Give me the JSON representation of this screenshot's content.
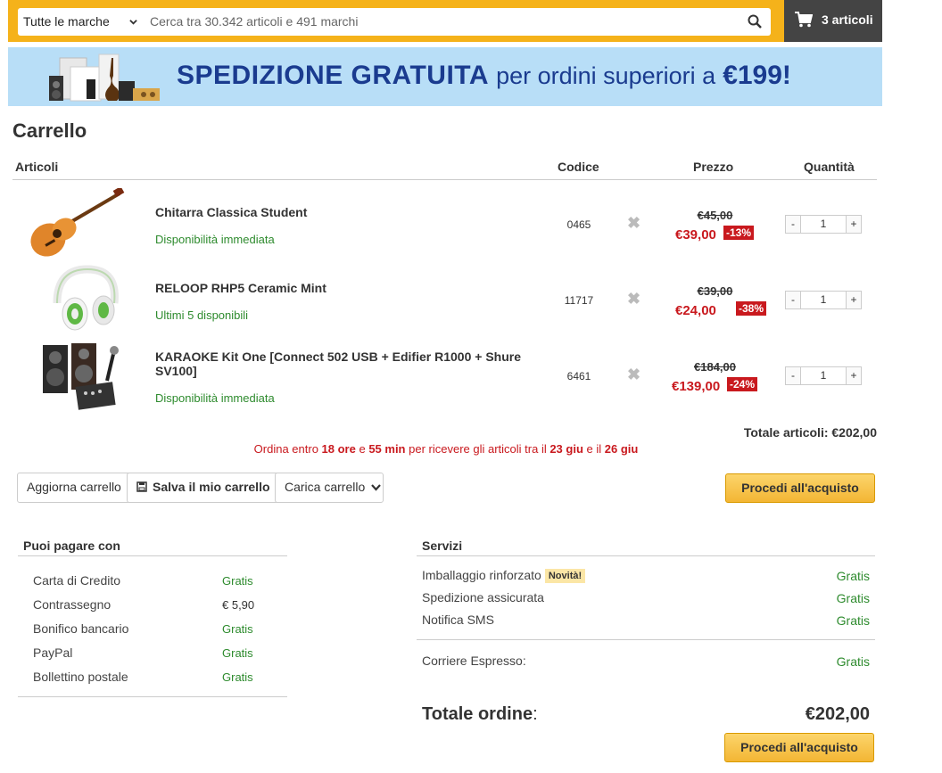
{
  "header": {
    "brand_select": "Tutte le marche",
    "search_placeholder": "Cerca tra 30.342 articoli e 491 marchi",
    "cart_label": "3 articoli"
  },
  "banner": {
    "bold": "SPEDIZIONE GRATUITA",
    "middle": "per ordini superiori a",
    "amount": "€199!"
  },
  "cart": {
    "title": "Carrello",
    "columns": {
      "items": "Articoli",
      "code": "Codice",
      "price": "Prezzo",
      "qty": "Quantità"
    },
    "rows": [
      {
        "name": "Chitarra Classica Student",
        "availability": "Disponibilità immediata",
        "code": "0465",
        "old_price": "€45,00",
        "price": "€39,00",
        "discount": "-13%",
        "qty": "1"
      },
      {
        "name": "RELOOP RHP5 Ceramic Mint",
        "availability": "Ultimi 5 disponibili",
        "code": "11717",
        "old_price": "€39,00",
        "price": "€24,00",
        "discount": "-38%",
        "qty": "1"
      },
      {
        "name": "KARAOKE Kit One [Connect 502 USB + Edifier R1000 + Shure SV100]",
        "availability": "Disponibilità immediata",
        "code": "6461",
        "old_price": "€184,00",
        "price": "€139,00",
        "discount": "-24%",
        "qty": "1"
      }
    ],
    "qty_minus": "-",
    "qty_plus": "+",
    "remove_glyph": "✖",
    "total_items": "Totale articoli: €202,00",
    "delivery": {
      "t1": "Ordina entro ",
      "hours": "18 ore",
      "t2": " e ",
      "mins": "55 min",
      "t3": " per ricevere gli articoli tra il ",
      "d1": "23 giu",
      "t4": " e il ",
      "d2": "26 giu"
    }
  },
  "actions": {
    "update": "Aggiorna carrello",
    "save": "Salva il mio carrello",
    "load": "Carica carrello",
    "checkout": "Procedi all'acquisto"
  },
  "payments": {
    "title": "Puoi pagare con",
    "items": [
      {
        "label": "Carta di Credito",
        "value": "Gratis"
      },
      {
        "label": "Contrassegno",
        "value": "€ 5,90"
      },
      {
        "label": "Bonifico bancario",
        "value": "Gratis"
      },
      {
        "label": "PayPal",
        "value": "Gratis"
      },
      {
        "label": "Bollettino postale",
        "value": "Gratis"
      }
    ]
  },
  "services": {
    "title": "Servizi",
    "items": [
      {
        "label": "Imballaggio rinforzato",
        "badge": "Novità!",
        "value": "Gratis"
      },
      {
        "label": "Spedizione assicurata",
        "value": "Gratis"
      },
      {
        "label": "Notifica SMS",
        "value": "Gratis"
      }
    ],
    "courier": {
      "label": "Corriere Espresso:",
      "value": "Gratis"
    }
  },
  "order_total": {
    "label": "Totale ordine",
    "colon": ":",
    "value": "€202,00"
  },
  "colors": {
    "accent": "#f5b21a",
    "price_red": "#c9191e",
    "green": "#2e8b2e",
    "banner_bg": "#b8def7"
  }
}
